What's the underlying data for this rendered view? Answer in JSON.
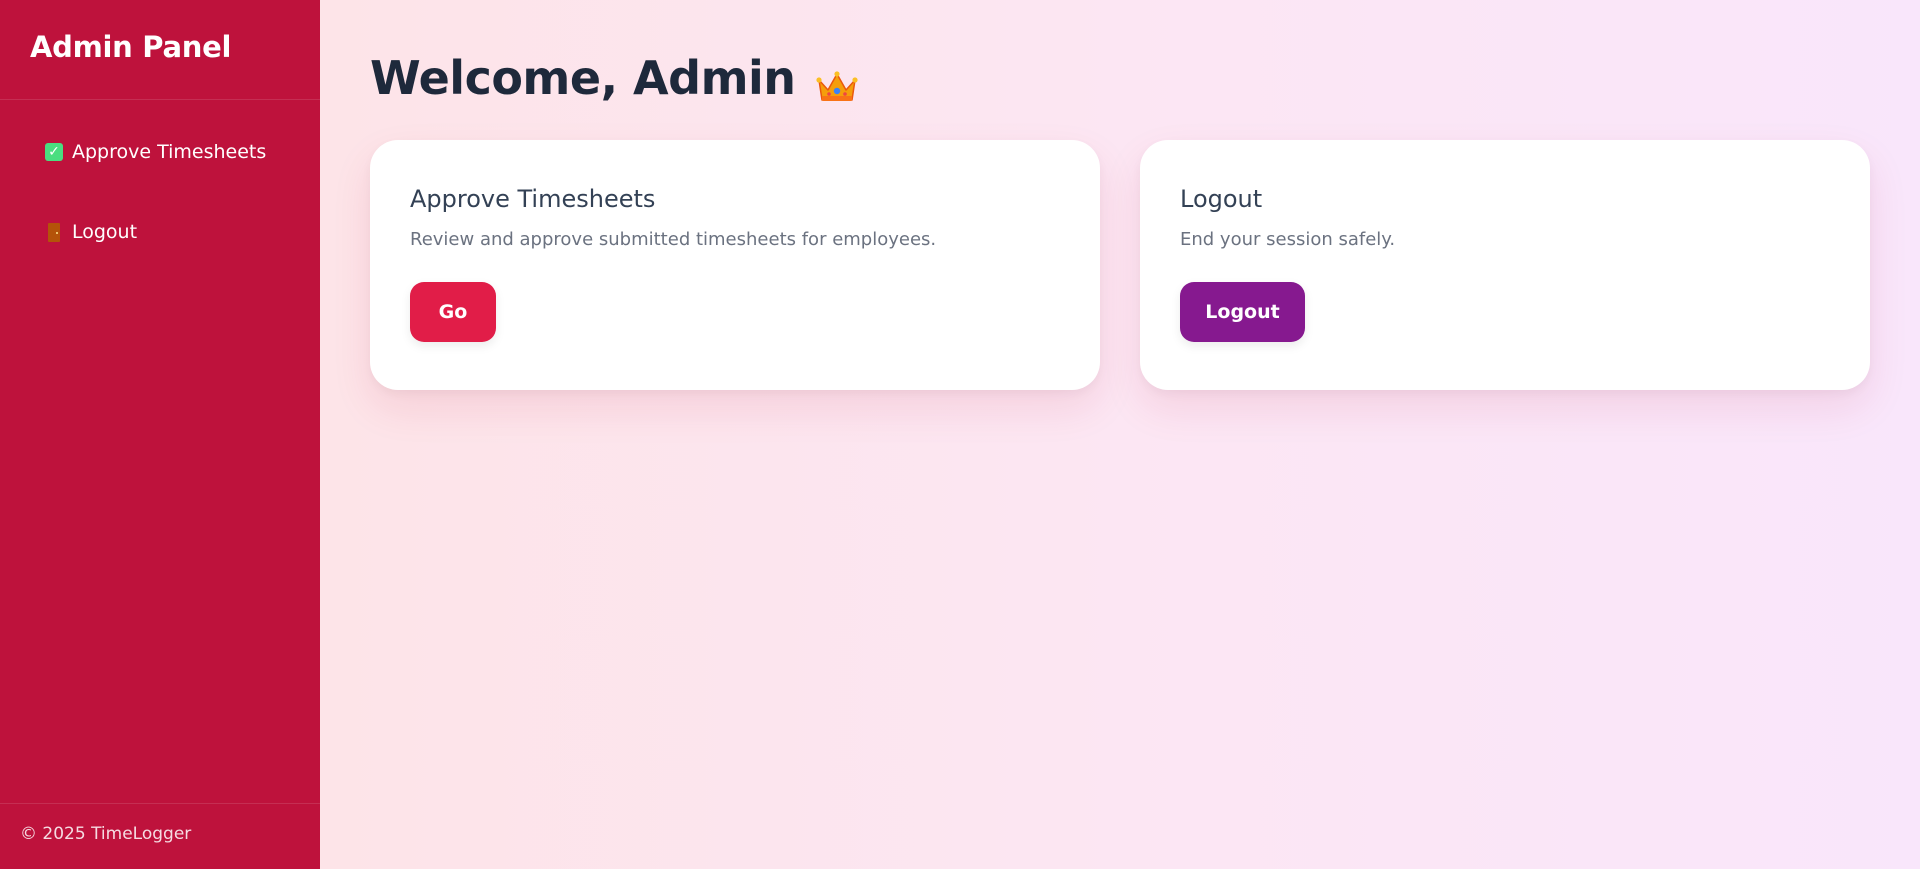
{
  "sidebar": {
    "brand": "Admin Panel",
    "items": [
      {
        "label": "Approve Timesheets",
        "icon": "check-box-icon"
      },
      {
        "label": "Logout",
        "icon": "door-icon"
      }
    ],
    "footer": "© 2025 TimeLogger"
  },
  "main": {
    "title": "Welcome, Admin",
    "title_icon": "crown-icon",
    "cards": [
      {
        "title": "Approve Timesheets",
        "description": "Review and approve submitted timesheets for employees.",
        "button": "Go"
      },
      {
        "title": "Logout",
        "description": "End your session safely.",
        "button": "Logout"
      }
    ]
  },
  "colors": {
    "sidebar_bg": "#be123c",
    "go_button": "#e11d48",
    "logout_button": "#86198f",
    "title_text": "#1e293b"
  }
}
